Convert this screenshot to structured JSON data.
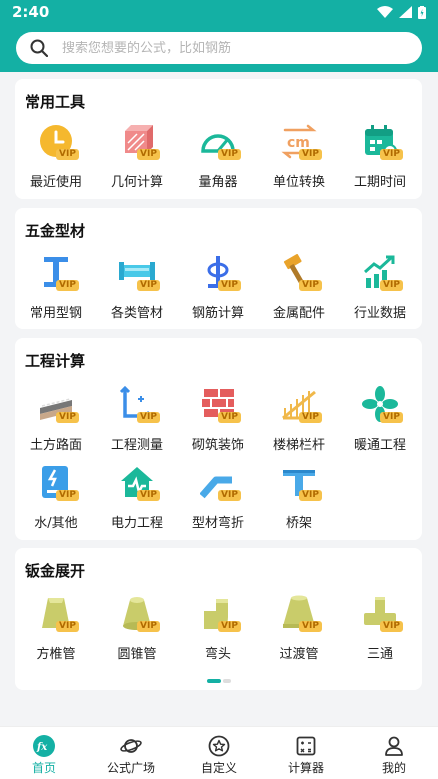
{
  "status": {
    "time": "2:40"
  },
  "search": {
    "placeholder": "搜索您想要的公式，比如钢筋"
  },
  "vip_label": "VIP",
  "sections": [
    {
      "title": "常用工具",
      "items": [
        {
          "label": "最近使用",
          "icon": "clock-icon"
        },
        {
          "label": "几何计算",
          "icon": "geometry-icon"
        },
        {
          "label": "量角器",
          "icon": "protractor-icon"
        },
        {
          "label": "单位转换",
          "icon": "unit-convert-icon"
        },
        {
          "label": "工期时间",
          "icon": "calendar-icon"
        }
      ]
    },
    {
      "title": "五金型材",
      "items": [
        {
          "label": "常用型钢",
          "icon": "i-beam-icon"
        },
        {
          "label": "各类管材",
          "icon": "pipe-icon"
        },
        {
          "label": "钢筋计算",
          "icon": "rebar-icon"
        },
        {
          "label": "金属配件",
          "icon": "hammer-icon"
        },
        {
          "label": "行业数据",
          "icon": "chart-icon"
        }
      ]
    },
    {
      "title": "工程计算",
      "items": [
        {
          "label": "土方路面",
          "icon": "road-icon"
        },
        {
          "label": "工程测量",
          "icon": "measure-icon"
        },
        {
          "label": "砌筑装饰",
          "icon": "brick-icon"
        },
        {
          "label": "楼梯栏杆",
          "icon": "stairs-icon"
        },
        {
          "label": "暖通工程",
          "icon": "fan-icon"
        },
        {
          "label": "水/其他",
          "icon": "water-icon"
        },
        {
          "label": "电力工程",
          "icon": "power-icon"
        },
        {
          "label": "型材弯折",
          "icon": "bend-icon"
        },
        {
          "label": "桥架",
          "icon": "bridge-icon"
        }
      ]
    },
    {
      "title": "钣金展开",
      "items": [
        {
          "label": "方椎管",
          "icon": "square-cone-icon"
        },
        {
          "label": "圆锥管",
          "icon": "round-cone-icon"
        },
        {
          "label": "弯头",
          "icon": "elbow-icon"
        },
        {
          "label": "过渡管",
          "icon": "transition-icon"
        },
        {
          "label": "三通",
          "icon": "tee-icon"
        }
      ]
    }
  ],
  "tabs": [
    {
      "label": "首页",
      "icon": "fx-icon",
      "active": true
    },
    {
      "label": "公式广场",
      "icon": "planet-icon",
      "active": false
    },
    {
      "label": "自定义",
      "icon": "star-circle-icon",
      "active": false
    },
    {
      "label": "计算器",
      "icon": "calculator-icon",
      "active": false
    },
    {
      "label": "我的",
      "icon": "user-icon",
      "active": false
    }
  ],
  "colors": {
    "accent": "#14b0a4",
    "vip": "#f6c24b",
    "background": "#f3f4f6"
  }
}
